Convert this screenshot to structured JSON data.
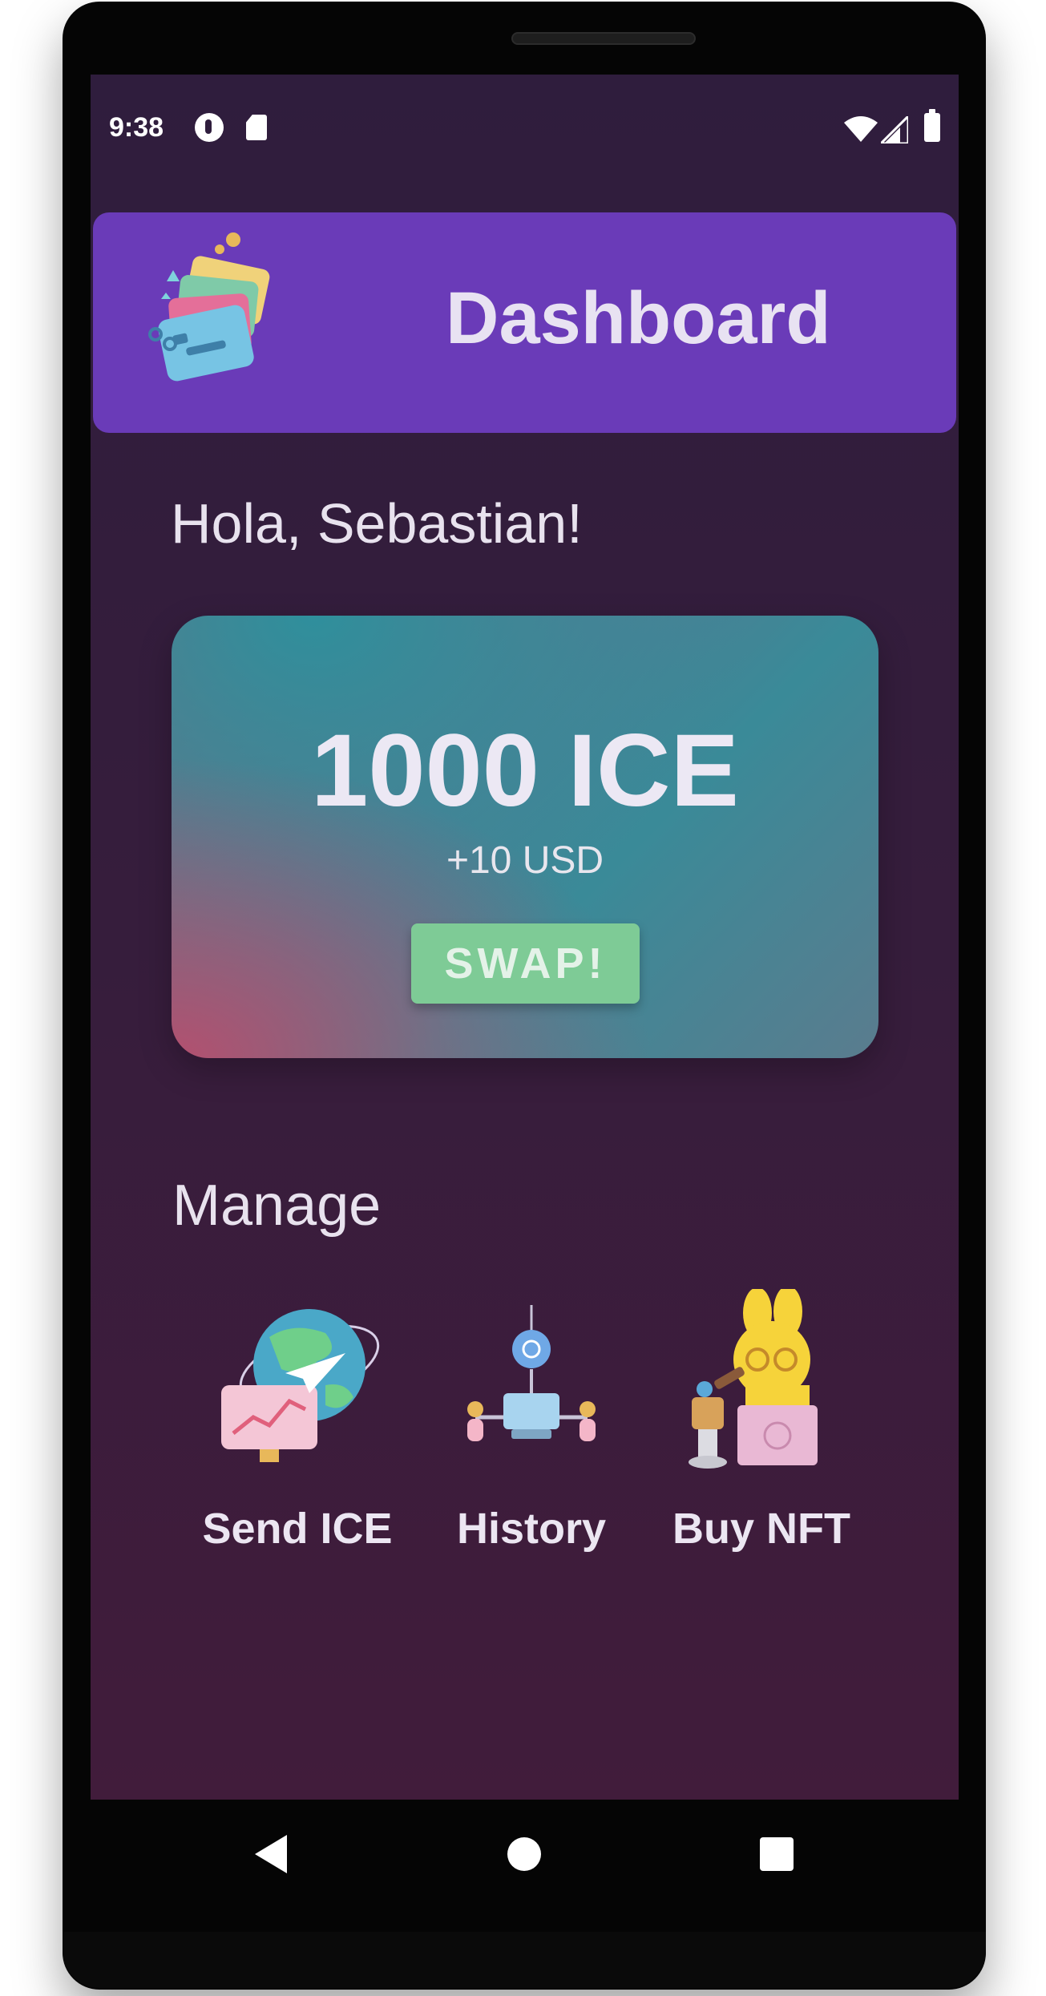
{
  "status_bar": {
    "time": "9:38"
  },
  "app_bar": {
    "title": "Dashboard",
    "logo_icon": "wallet-cards-icon"
  },
  "greeting": "Hola, Sebastian!",
  "balance": {
    "amount": "1000 ICE",
    "usd": "+10 USD",
    "swap_label": "SWAP!"
  },
  "manage": {
    "title": "Manage",
    "actions": [
      {
        "label": "Send ICE",
        "icon": "globe-send-icon"
      },
      {
        "label": "History",
        "icon": "network-history-icon"
      },
      {
        "label": "Buy NFT",
        "icon": "bunny-auction-icon"
      }
    ]
  },
  "colors": {
    "background": "#361d3c",
    "app_bar": "#6a3bb8",
    "swap_button": "#7ecb96"
  }
}
